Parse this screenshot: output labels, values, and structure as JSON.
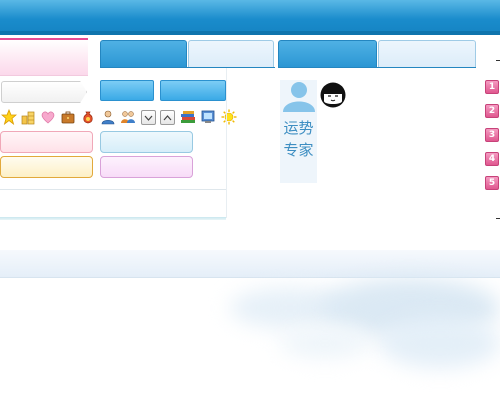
{
  "header": {},
  "tabs": [
    {
      "state": "active"
    },
    {
      "state": "inactive"
    },
    {
      "state": "active"
    },
    {
      "state": "inactive"
    }
  ],
  "icons": [
    "star-icon",
    "coin-stack-icon",
    "heart-icon",
    "briefcase-icon",
    "money-bag-icon",
    "person-icon",
    "people-icon",
    "chevron-down-icon",
    "chevron-up-icon",
    "books-icon",
    "monitor-icon",
    "sun-icon"
  ],
  "user_card": {
    "line1": "运势",
    "line2": "专家"
  },
  "numbered_list": [
    "1",
    "2",
    "3",
    "4",
    "5"
  ],
  "colors": {
    "header_blue": "#1a8ccc",
    "accent_pink": "#e84b93",
    "card_text": "#3d8ec2",
    "badge_pink": "#e0578f"
  }
}
